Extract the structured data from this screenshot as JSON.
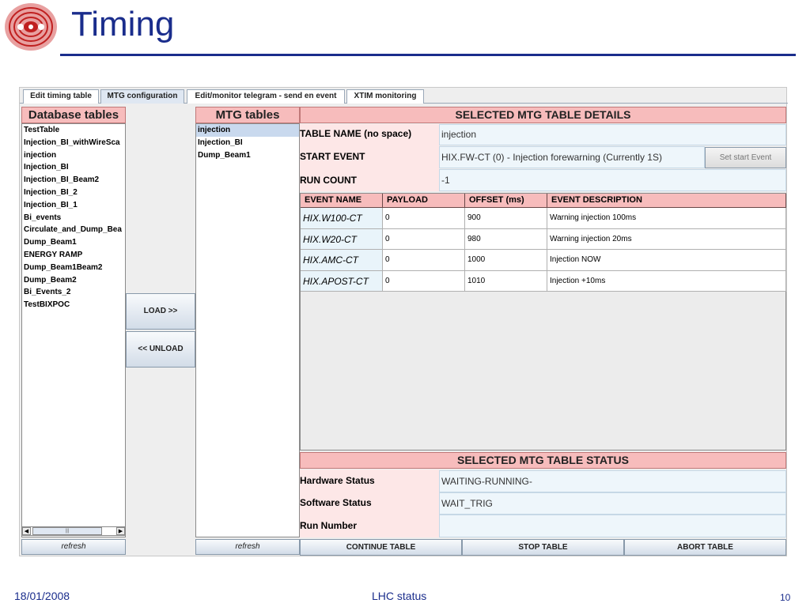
{
  "slide": {
    "title": "Timing",
    "footer_date": "18/01/2008",
    "footer_center": "LHC status",
    "page_number": "10"
  },
  "tabs": [
    {
      "label": "Edit timing table",
      "active": false
    },
    {
      "label": "MTG configuration",
      "active": true
    },
    {
      "label": "Edit/monitor telegram - send en event",
      "active": false
    },
    {
      "label": "XTIM monitoring",
      "active": false
    }
  ],
  "database": {
    "header": "Database tables",
    "items": [
      "TestTable",
      "Injection_BI_withWireSca",
      "injection",
      "Injection_BI",
      "Injection_BI_Beam2",
      "Injection_BI_2",
      "Injection_BI_1",
      "Bi_events",
      "Circulate_and_Dump_Bea",
      "Dump_Beam1",
      "ENERGY RAMP",
      "Dump_Beam1Beam2",
      "Dump_Beam2",
      "Bi_Events_2",
      "TestBIXPOC"
    ],
    "scroll_thumb": "|||",
    "scroll_left": "◀",
    "scroll_right": "▶",
    "refresh_label": "refresh"
  },
  "buttons": {
    "load": "LOAD >>",
    "unload": "<< UNLOAD"
  },
  "mtg": {
    "header": "MTG tables",
    "items": [
      "injection",
      "Injection_BI",
      "Dump_Beam1"
    ],
    "selected_index": 0,
    "refresh_label": "refresh"
  },
  "details": {
    "header": "SELECTED MTG TABLE DETAILS",
    "table_name_label": "TABLE NAME (no space)",
    "table_name_value": "injection",
    "start_event_label": "START EVENT",
    "start_event_value": "HIX.FW-CT (0) - Injection forewarning (Currently 1S)",
    "set_start_button": "Set start Event",
    "run_count_label": "RUN COUNT",
    "run_count_value": "-1"
  },
  "events_table": {
    "columns": [
      "EVENT NAME",
      "PAYLOAD",
      "OFFSET (ms)",
      "EVENT DESCRIPTION"
    ],
    "rows": [
      [
        "HIX.W100-CT",
        "0",
        "900",
        "Warning injection 100ms"
      ],
      [
        "HIX.W20-CT",
        "0",
        "980",
        "Warning injection 20ms"
      ],
      [
        "HIX.AMC-CT",
        "0",
        "1000",
        "Injection NOW"
      ],
      [
        "HIX.APOST-CT",
        "0",
        "1010",
        "Injection +10ms"
      ]
    ]
  },
  "status": {
    "header": "SELECTED MTG TABLE STATUS",
    "hardware_label": "Hardware Status",
    "hardware_value": "WAITING-RUNNING-",
    "software_label": "Software Status",
    "software_value": "WAIT_TRIG",
    "run_number_label": "Run Number",
    "run_number_value": ""
  },
  "actions": {
    "continue": "CONTINUE TABLE",
    "stop": "STOP TABLE",
    "abort": "ABORT TABLE"
  },
  "colors": {
    "title_blue": "#1a2d8c",
    "header_pink": "#f7bcbc",
    "label_pink": "#fde7e7",
    "value_blue": "#eef6fb"
  }
}
